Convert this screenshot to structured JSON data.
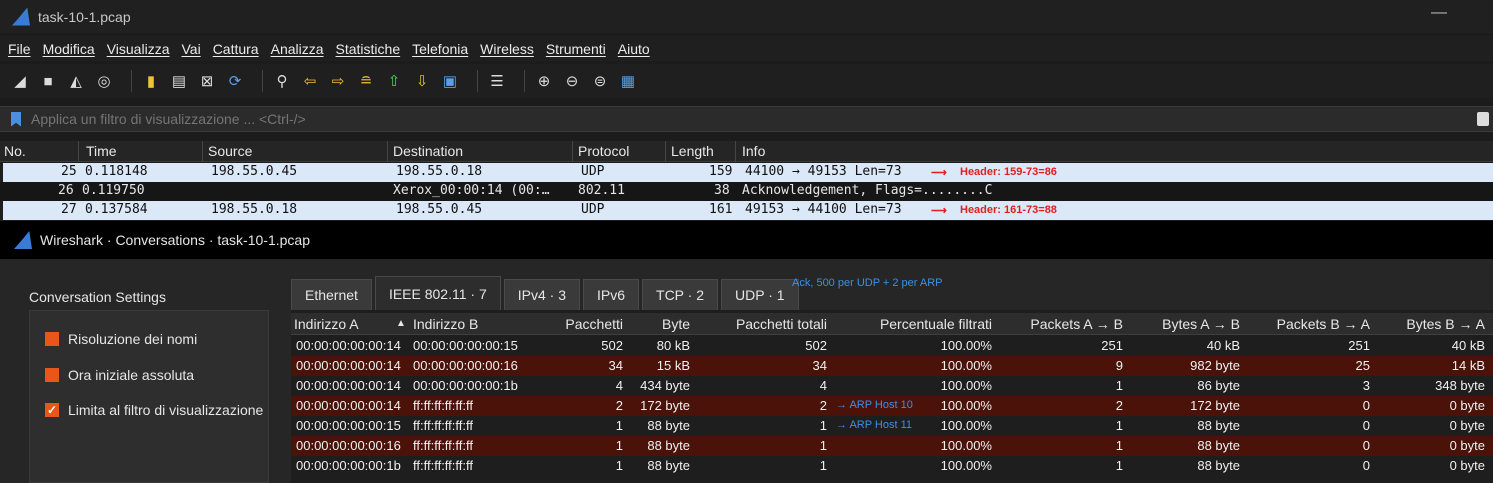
{
  "window": {
    "title": "task-10-1.pcap",
    "minimize_glyph": "—"
  },
  "menu": [
    "File",
    "Modifica",
    "Visualizza",
    "Vai",
    "Cattura",
    "Analizza",
    "Statistiche",
    "Telefonia",
    "Wireless",
    "Strumenti",
    "Aiuto"
  ],
  "toolbar_icons": [
    "shark-fin-start-icon",
    "stop-icon",
    "restart-icon",
    "options-gear-icon",
    "open-file-icon",
    "save-icon",
    "close-file-icon",
    "reload-icon",
    "find-icon",
    "back-arrow-icon",
    "forward-arrow-icon",
    "go-to-packet-icon",
    "first-packet-icon",
    "last-packet-icon",
    "autoscroll-icon",
    "colorize-icon",
    "zoom-in-icon",
    "zoom-out-icon",
    "normal-size-icon",
    "resize-columns-icon"
  ],
  "filter": {
    "placeholder": "Applica un filtro di visualizzazione ... <Ctrl-/>"
  },
  "packet_list": {
    "columns": [
      "No.",
      "Time",
      "Source",
      "Destination",
      "Protocol",
      "Length",
      "Info"
    ],
    "rows": [
      {
        "no": "25",
        "time": "0.118148",
        "source": "198.55.0.45",
        "destination": "198.55.0.18",
        "protocol": "UDP",
        "length": "159",
        "info": "44100 → 49153 Len=73",
        "note": "Header: 159-73=86"
      },
      {
        "no": "26",
        "time": "0.119750",
        "source": "",
        "destination": "Xerox_00:00:14 (00:…",
        "protocol": "802.11",
        "length": "38",
        "info": "Acknowledgement, Flags=........C",
        "note": ""
      },
      {
        "no": "27",
        "time": "0.137584",
        "source": "198.55.0.18",
        "destination": "198.55.0.45",
        "protocol": "UDP",
        "length": "161",
        "info": "49153 → 44100 Len=73",
        "note": "Header: 161-73=88"
      }
    ]
  },
  "conversations": {
    "title": "Wireshark · Conversations · task-10-1.pcap",
    "settings_title": "Conversation Settings",
    "options": [
      {
        "label": "Risoluzione dei nomi",
        "checked": false
      },
      {
        "label": "Ora iniziale assoluta",
        "checked": false
      },
      {
        "label": "Limita al filtro di visualizzazione",
        "checked": true
      }
    ],
    "tabs": [
      "Ethernet",
      "IEEE 802.11 · 7",
      "IPv4 · 3",
      "IPv6",
      "TCP · 2",
      "UDP · 1"
    ],
    "active_tab": "IEEE 802.11 · 7",
    "tab_note": "Ack, 500 per UDP + 2 per ARP",
    "columns": [
      "Indirizzo A",
      "Indirizzo B",
      "Pacchetti",
      "Byte",
      "Pacchetti totali",
      "Percentuale filtrati",
      "Packets A → B",
      "Bytes A → B",
      "Packets B → A",
      "Bytes B → A"
    ],
    "rows": [
      {
        "addr_a": "00:00:00:00:00:14",
        "addr_b": "00:00:00:00:00:15",
        "packets": "502",
        "bytes": "80 kB",
        "total": "502",
        "pct": "100.00%",
        "pab": "251",
        "bab": "40 kB",
        "pba": "251",
        "bba": "40 kB",
        "note": ""
      },
      {
        "addr_a": "00:00:00:00:00:14",
        "addr_b": "00:00:00:00:00:16",
        "packets": "34",
        "bytes": "15 kB",
        "total": "34",
        "pct": "100.00%",
        "pab": "9",
        "bab": "982 byte",
        "pba": "25",
        "bba": "14 kB",
        "note": ""
      },
      {
        "addr_a": "00:00:00:00:00:14",
        "addr_b": "00:00:00:00:00:1b",
        "packets": "4",
        "bytes": "434 byte",
        "total": "4",
        "pct": "100.00%",
        "pab": "1",
        "bab": "86 byte",
        "pba": "3",
        "bba": "348 byte",
        "note": ""
      },
      {
        "addr_a": "00:00:00:00:00:14",
        "addr_b": "ff:ff:ff:ff:ff:ff",
        "packets": "2",
        "bytes": "172 byte",
        "total": "2",
        "pct": "100.00%",
        "pab": "2",
        "bab": "172 byte",
        "pba": "0",
        "bba": "0 byte",
        "note": "→ ARP Host 10"
      },
      {
        "addr_a": "00:00:00:00:00:15",
        "addr_b": "ff:ff:ff:ff:ff:ff",
        "packets": "1",
        "bytes": "88 byte",
        "total": "1",
        "pct": "100.00%",
        "pab": "1",
        "bab": "88 byte",
        "pba": "0",
        "bba": "0 byte",
        "note": "→ ARP Host 11"
      },
      {
        "addr_a": "00:00:00:00:00:16",
        "addr_b": "ff:ff:ff:ff:ff:ff",
        "packets": "1",
        "bytes": "88 byte",
        "total": "1",
        "pct": "100.00%",
        "pab": "1",
        "bab": "88 byte",
        "pba": "0",
        "bba": "0 byte",
        "note": ""
      },
      {
        "addr_a": "00:00:00:00:00:1b",
        "addr_b": "ff:ff:ff:ff:ff:ff",
        "packets": "1",
        "bytes": "88 byte",
        "total": "1",
        "pct": "100.00%",
        "pab": "1",
        "bab": "88 byte",
        "pba": "0",
        "bba": "0 byte",
        "note": ""
      }
    ]
  }
}
